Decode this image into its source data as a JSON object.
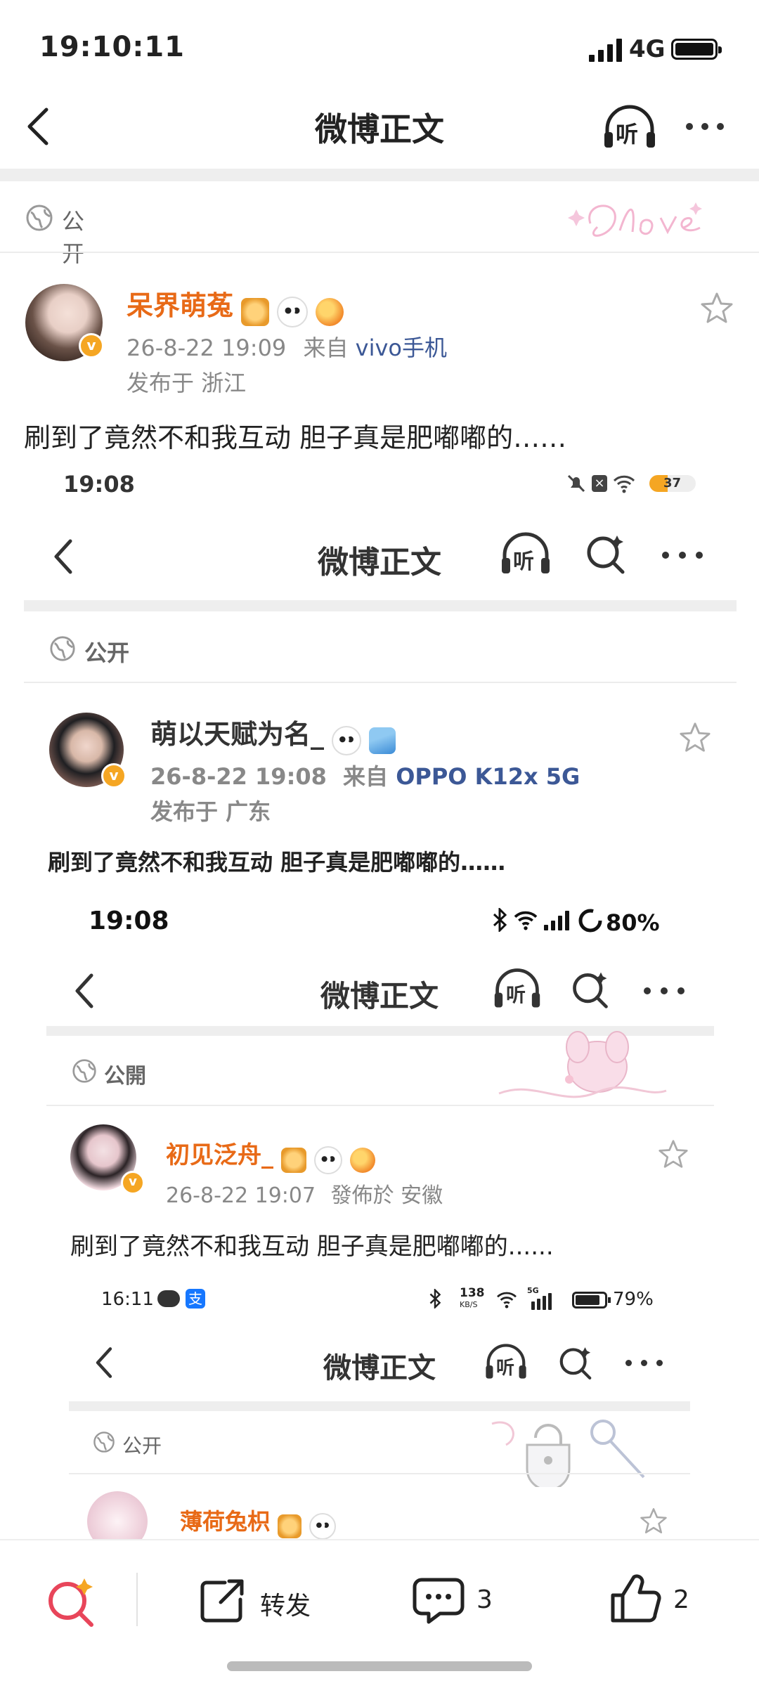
{
  "status_bar": {
    "time": "19:10:11",
    "network": "4G"
  },
  "header": {
    "title": "微博正文",
    "listen_label": "听"
  },
  "visibility": "公开",
  "post": {
    "author": "呆界萌菟",
    "date": "26-8-22 19:09",
    "source_prefix": "来自",
    "source": "vivo手机",
    "location": "发布于 浙江",
    "content": "刷到了竟然不和我互动 胆子真是肥嘟嘟的……",
    "avatar_badge": "v"
  },
  "nested1": {
    "time": "19:08",
    "battery": "37",
    "title": "微博正文",
    "listen_label": "听",
    "visibility": "公开",
    "author": "萌以天赋为名_",
    "date": "26-8-22 19:08",
    "source_prefix": "来自",
    "source": "OPPO K12x 5G",
    "location": "发布于 广东",
    "content": "刷到了竟然不和我互动 胆子真是肥嘟嘟的……",
    "avatar_badge": "v"
  },
  "nested2": {
    "time": "19:08",
    "battery": "80%",
    "title": "微博正文",
    "listen_label": "听",
    "visibility": "公開",
    "author": "初见泛舟_",
    "date": "26-8-22 19:07",
    "location": "發佈於 安徽",
    "content": "刷到了竟然不和我互动 胆子真是肥嘟嘟的......",
    "avatar_badge": "v"
  },
  "nested3": {
    "time": "16:11",
    "speed": "138",
    "speed_unit": "KB/S",
    "network": "5G",
    "battery": "79%",
    "title": "微博正文",
    "listen_label": "听",
    "visibility": "公开",
    "author": "薄荷兔枳"
  },
  "bottom_bar": {
    "repost_label": "转发",
    "comment_count": "3",
    "like_count": "2"
  },
  "colors": {
    "author": "#e86a17",
    "source_link": "#3c5896",
    "badge": "#f5a623",
    "search_accent": "#e8455a"
  }
}
